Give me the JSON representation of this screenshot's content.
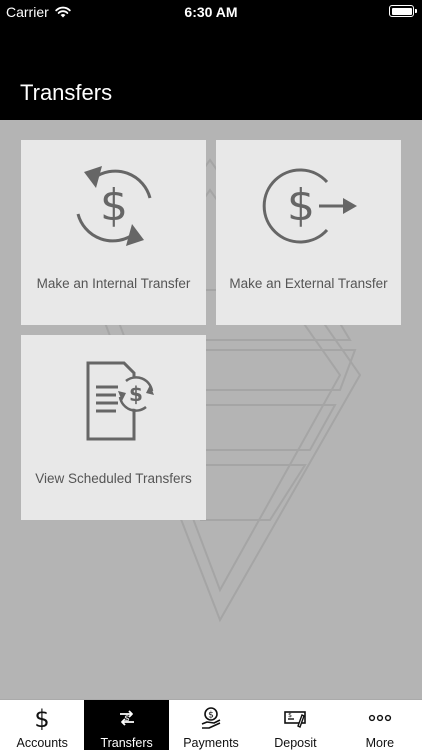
{
  "status_bar": {
    "carrier": "Carrier",
    "time": "6:30 AM",
    "icons": [
      "wifi-icon",
      "battery-icon"
    ]
  },
  "header": {
    "title": "Transfers"
  },
  "tiles": [
    {
      "label": "Make an Internal Transfer",
      "icon": "internal-transfer-icon"
    },
    {
      "label": "Make an External Transfer",
      "icon": "external-transfer-icon"
    },
    {
      "label": "View Scheduled Transfers",
      "icon": "scheduled-transfers-icon"
    }
  ],
  "tab_bar": {
    "items": [
      {
        "label": "Accounts",
        "icon": "dollar-icon"
      },
      {
        "label": "Transfers",
        "icon": "transfer-arrows-icon",
        "active": true
      },
      {
        "label": "Payments",
        "icon": "payments-hand-icon"
      },
      {
        "label": "Deposit",
        "icon": "check-deposit-icon"
      },
      {
        "label": "More",
        "icon": "more-dots-icon"
      }
    ]
  },
  "colors": {
    "header_bg": "#000000",
    "content_bg": "#b4b4b4",
    "tile_bg": "#e8e8e8",
    "icon_gray": "#666666",
    "active_tab_bg": "#000000"
  }
}
